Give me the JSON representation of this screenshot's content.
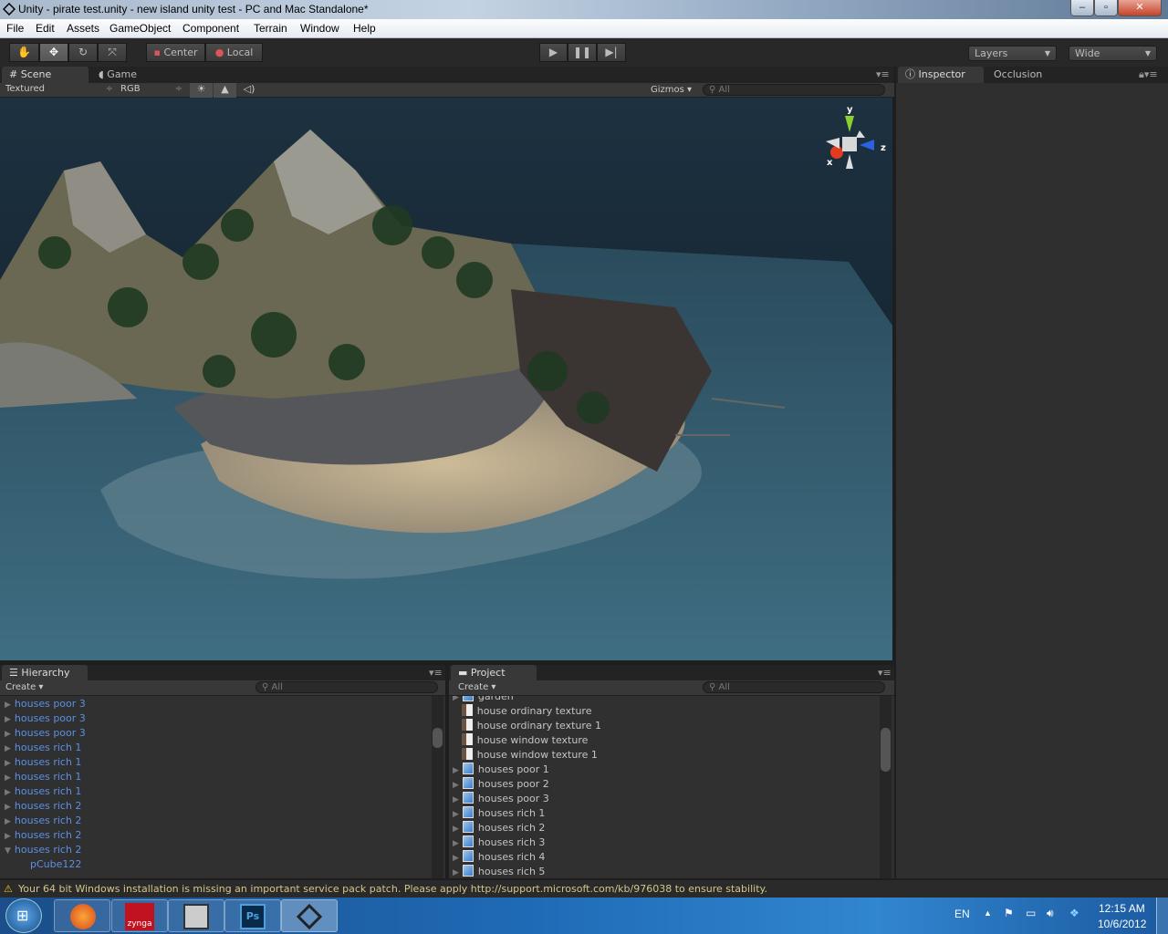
{
  "window": {
    "title": "Unity - pirate test.unity - new island unity test - PC and Mac Standalone*",
    "controls": [
      "minimize",
      "maximize",
      "close"
    ]
  },
  "menu": [
    "File",
    "Edit",
    "Assets",
    "GameObject",
    "Component",
    "Terrain",
    "Window",
    "Help"
  ],
  "toolbar": {
    "tools": [
      "hand-icon",
      "move-icon",
      "rotate-icon",
      "scale-icon"
    ],
    "active_tool": "move",
    "pivot": "Center",
    "space": "Local",
    "layers": "Layers",
    "layout": "Wide"
  },
  "scene": {
    "tabs": [
      "Scene",
      "Game"
    ],
    "active_tab": "Scene",
    "render_mode": "Textured",
    "channel": "RGB",
    "gizmos": "Gizmos",
    "search_placeholder": "All",
    "axes": {
      "x": "x",
      "y": "y",
      "z": "z"
    }
  },
  "inspector": {
    "tabs": [
      "Inspector",
      "Occlusion"
    ],
    "active_tab": "Inspector"
  },
  "hierarchy": {
    "title": "Hierarchy",
    "create": "Create",
    "search_placeholder": "All",
    "items": [
      {
        "label": "houses poor 3",
        "expanded": false
      },
      {
        "label": "houses poor 3",
        "expanded": false
      },
      {
        "label": "houses poor 3",
        "expanded": false
      },
      {
        "label": "houses rich 1",
        "expanded": false
      },
      {
        "label": "houses rich 1",
        "expanded": false
      },
      {
        "label": "houses rich 1",
        "expanded": false
      },
      {
        "label": "houses rich 1",
        "expanded": false
      },
      {
        "label": "houses rich 2",
        "expanded": false
      },
      {
        "label": "houses rich 2",
        "expanded": false
      },
      {
        "label": "houses rich 2",
        "expanded": false
      },
      {
        "label": "houses rich 2",
        "expanded": true
      },
      {
        "label": "pCube122",
        "child": true
      }
    ]
  },
  "project": {
    "title": "Project",
    "create": "Create",
    "search_placeholder": "All",
    "items": [
      {
        "label": "garden",
        "type": "prefab"
      },
      {
        "label": "house ordinary texture",
        "type": "texture"
      },
      {
        "label": "house ordinary texture 1",
        "type": "texture"
      },
      {
        "label": "house window texture",
        "type": "texture"
      },
      {
        "label": "house window texture 1",
        "type": "texture"
      },
      {
        "label": "houses poor 1",
        "type": "prefab"
      },
      {
        "label": "houses poor 2",
        "type": "prefab"
      },
      {
        "label": "houses poor 3",
        "type": "prefab"
      },
      {
        "label": "houses rich 1",
        "type": "prefab"
      },
      {
        "label": "houses rich 2",
        "type": "prefab"
      },
      {
        "label": "houses rich 3",
        "type": "prefab"
      },
      {
        "label": "houses rich 4",
        "type": "prefab"
      },
      {
        "label": "houses rich 5",
        "type": "prefab"
      }
    ]
  },
  "status": {
    "message": "Your 64 bit Windows installation is missing an important service pack patch. Please apply http://support.microsoft.com/kb/976038 to ensure stability.",
    "icon": "warning-icon"
  },
  "taskbar": {
    "apps": [
      "firefox",
      "zynga",
      "calculator",
      "photoshop",
      "unity"
    ],
    "zynga_label": "zynga",
    "ps_label": "Ps",
    "language": "EN",
    "time": "12:15 AM",
    "date": "10/6/2012"
  },
  "colors": {
    "hierarchy_prefab": "#5b8fe6",
    "warning": "#d3c58a",
    "accent_y": "#8bd12d",
    "accent_z": "#2a62e0",
    "accent_x": "#e33b1f"
  }
}
